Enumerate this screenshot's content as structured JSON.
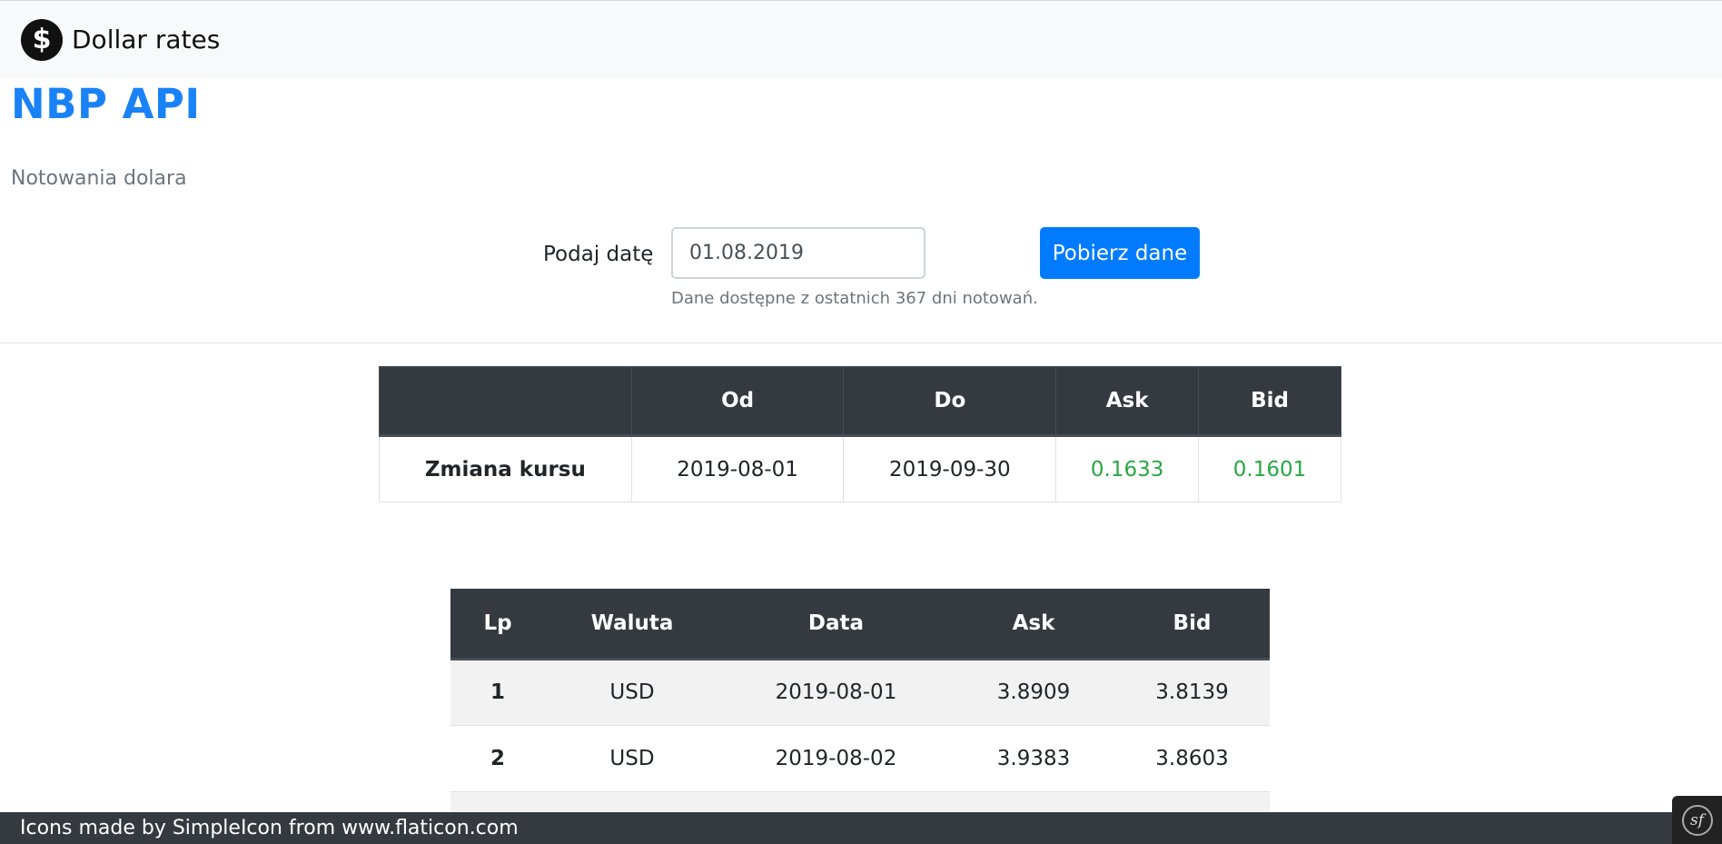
{
  "navbar": {
    "brand_icon": "$",
    "brand_text": "Dollar rates"
  },
  "header": {
    "title": "NBP API",
    "subtitle": "Notowania dolara"
  },
  "form": {
    "date_label": "Podaj datę",
    "date_value": "01.08.2019",
    "help_text": "Dane dostępne z ostatnich 367 dni notowań.",
    "submit_label": "Pobierz dane"
  },
  "summary": {
    "headers": [
      "",
      "Od",
      "Do",
      "Ask",
      "Bid"
    ],
    "row": {
      "label": "Zmiana kursu",
      "from": "2019-08-01",
      "to": "2019-09-30",
      "ask": "0.1633",
      "bid": "0.1601"
    },
    "change_color": "#28a745"
  },
  "rates": {
    "headers": [
      "Lp",
      "Waluta",
      "Data",
      "Ask",
      "Bid"
    ],
    "rows": [
      {
        "lp": "1",
        "currency": "USD",
        "date": "2019-08-01",
        "ask": "3.8909",
        "bid": "3.8139"
      },
      {
        "lp": "2",
        "currency": "USD",
        "date": "2019-08-02",
        "ask": "3.9383",
        "bid": "3.8603"
      }
    ]
  },
  "footer": {
    "text": "Icons made by SimpleIcon from www.flaticon.com"
  },
  "debug_toolbar": {
    "icon": "symfony-icon",
    "text": "sf"
  },
  "colors": {
    "accent": "#007bff",
    "title": "#1a82f7",
    "dark": "#343a40"
  }
}
